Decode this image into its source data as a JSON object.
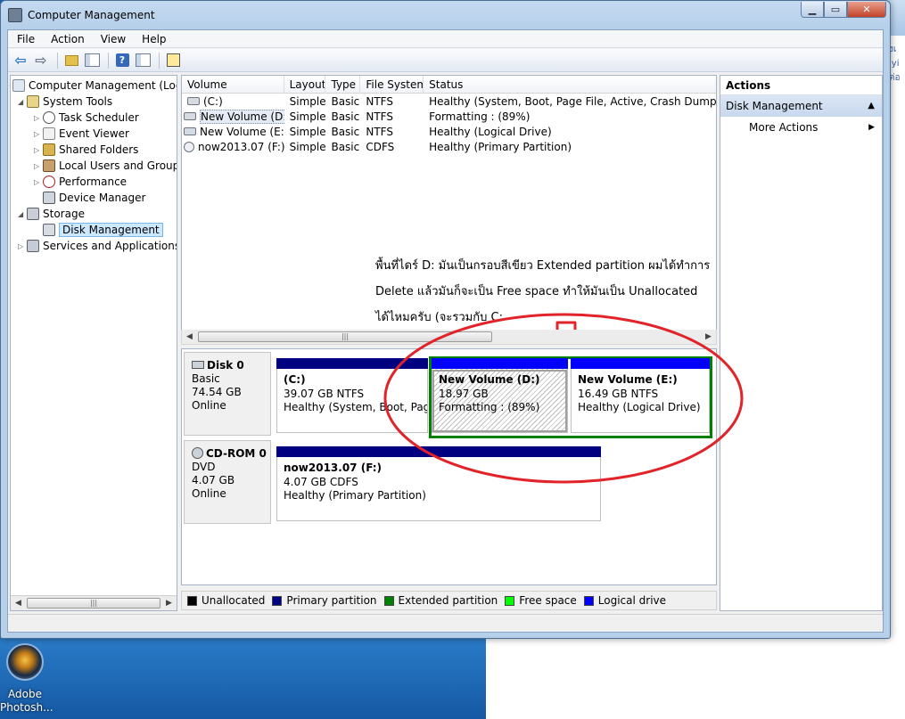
{
  "window": {
    "title": "Computer Management"
  },
  "background": {
    "sidebar_fragments": [
      "่งเ",
      "iyi",
      "ต่อ"
    ],
    "desktop_icon_label": "Adobe Photosh..."
  },
  "menu": [
    "File",
    "Action",
    "View",
    "Help"
  ],
  "tree": [
    {
      "label": "Computer Management (Local",
      "icon": "computer-icon"
    },
    {
      "label": "System Tools",
      "icon": "tools-icon"
    },
    {
      "label": "Task Scheduler",
      "icon": "clock-icon"
    },
    {
      "label": "Event Viewer",
      "icon": "event-viewer-icon"
    },
    {
      "label": "Shared Folders",
      "icon": "shared-folder-icon"
    },
    {
      "label": "Local Users and Groups",
      "icon": "users-icon"
    },
    {
      "label": "Performance",
      "icon": "performance-icon"
    },
    {
      "label": "Device Manager",
      "icon": "device-manager-icon"
    },
    {
      "label": "Storage",
      "icon": "storage-icon"
    },
    {
      "label": "Disk Management",
      "icon": "disk-icon"
    },
    {
      "label": "Services and Applications",
      "icon": "services-icon"
    }
  ],
  "volume_list": {
    "columns": [
      "Volume",
      "Layout",
      "Type",
      "File System",
      "Status"
    ],
    "rows": [
      {
        "volume": "(C:)",
        "layout": "Simple",
        "type": "Basic",
        "fs": "NTFS",
        "status": "Healthy (System, Boot, Page File, Active, Crash Dump, Prima"
      },
      {
        "volume": "New Volume (D:)",
        "layout": "Simple",
        "type": "Basic",
        "fs": "NTFS",
        "status": "Formatting : (89%)"
      },
      {
        "volume": "New Volume (E:)",
        "layout": "Simple",
        "type": "Basic",
        "fs": "NTFS",
        "status": "Healthy (Logical Drive)"
      },
      {
        "volume": "now2013.07 (F:)",
        "layout": "Simple",
        "type": "Basic",
        "fs": "CDFS",
        "status": "Healthy (Primary Partition)"
      }
    ]
  },
  "annotation": {
    "line1": "พื้นที่ไดร์ D: มันเป็นกรอบสีเขียว Extended partition ผมได้ทำการ",
    "line2": "Delete แล้วมันก็จะเป็น Free space  ทำให้มันเป็น Unallocated",
    "line3": "ได้ไหมครับ (จะรวมกับ C:"
  },
  "disks": {
    "disk0": {
      "name": "Disk 0",
      "type": "Basic",
      "size": "74.54 GB",
      "state": "Online",
      "c": {
        "name": "(C:)",
        "size": "39.07 GB NTFS",
        "status": "Healthy (System, Boot, Page F"
      },
      "d": {
        "name": "New Volume  (D:)",
        "size": "18.97 GB",
        "status": "Formatting : (89%)"
      },
      "e": {
        "name": "New Volume  (E:)",
        "size": "16.49 GB NTFS",
        "status": "Healthy (Logical Drive)"
      }
    },
    "cdrom0": {
      "name": "CD-ROM 0",
      "type": "DVD",
      "size": "4.07 GB",
      "state": "Online",
      "f": {
        "name": "now2013.07  (F:)",
        "size": "4.07 GB CDFS",
        "status": "Healthy (Primary Partition)"
      }
    }
  },
  "legend": [
    {
      "label": "Unallocated",
      "color": "#000000"
    },
    {
      "label": "Primary partition",
      "color": "#000080"
    },
    {
      "label": "Extended partition",
      "color": "#008000"
    },
    {
      "label": "Free space",
      "color": "#00ff00"
    },
    {
      "label": "Logical drive",
      "color": "#0000ff"
    }
  ],
  "actions": {
    "header": "Actions",
    "section": "Disk Management",
    "more": "More Actions"
  },
  "colors": {
    "annotation_red": "#e0242a",
    "extended_green": "#008000",
    "primary_navy": "#000080",
    "logical_blue": "#0000ff"
  }
}
